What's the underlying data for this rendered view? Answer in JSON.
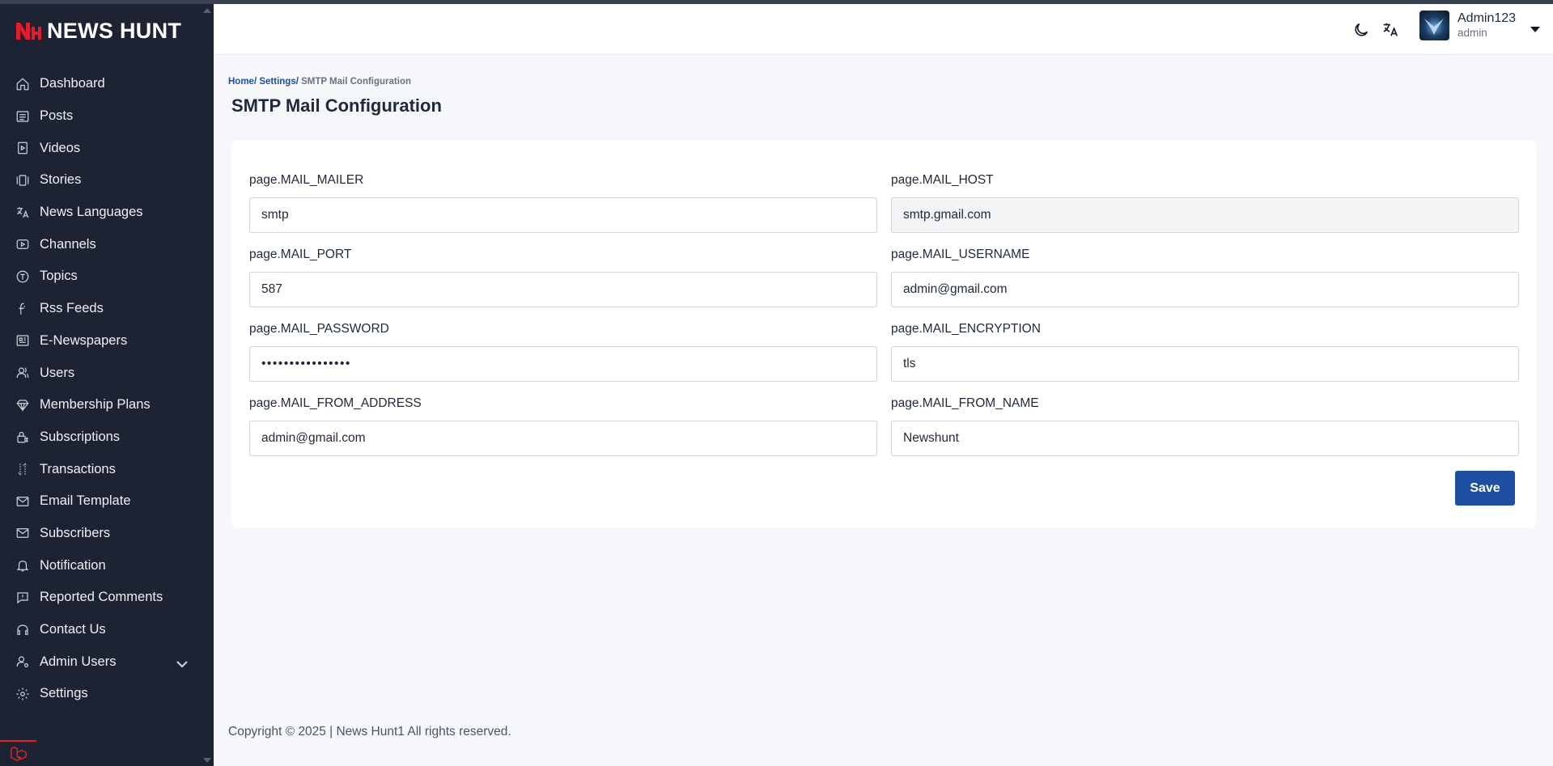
{
  "brand": {
    "name": "NEWS HUNT",
    "accent": "#e11d2e"
  },
  "sidebar": {
    "items": [
      {
        "label": "Dashboard",
        "icon": "home-icon"
      },
      {
        "label": "Posts",
        "icon": "list-icon"
      },
      {
        "label": "Videos",
        "icon": "video-file-icon"
      },
      {
        "label": "Stories",
        "icon": "stories-icon"
      },
      {
        "label": "News Languages",
        "icon": "translate-icon"
      },
      {
        "label": "Channels",
        "icon": "channel-icon"
      },
      {
        "label": "Topics",
        "icon": "topic-icon"
      },
      {
        "label": "Rss Feeds",
        "icon": "rss-icon"
      },
      {
        "label": "E-Newspapers",
        "icon": "newspaper-icon"
      },
      {
        "label": "Users",
        "icon": "users-icon"
      },
      {
        "label": "Membership Plans",
        "icon": "diamond-icon"
      },
      {
        "label": "Subscriptions",
        "icon": "subscription-icon"
      },
      {
        "label": "Transactions",
        "icon": "transactions-icon"
      },
      {
        "label": "Email Template",
        "icon": "mail-icon"
      },
      {
        "label": "Subscribers",
        "icon": "mail-icon"
      },
      {
        "label": "Notification",
        "icon": "bell-icon"
      },
      {
        "label": "Reported Comments",
        "icon": "comment-alert-icon"
      },
      {
        "label": "Contact Us",
        "icon": "headset-icon"
      },
      {
        "label": "Admin Users",
        "icon": "admin-user-icon",
        "expandable": true
      },
      {
        "label": "Settings",
        "icon": "gear-icon"
      }
    ]
  },
  "header": {
    "user": {
      "name": "Admin123",
      "role": "admin"
    }
  },
  "breadcrumb": {
    "home": "Home/",
    "settings": "Settings/",
    "current": "SMTP Mail Configuration"
  },
  "page": {
    "title": "SMTP Mail Configuration"
  },
  "form": {
    "mail_mailer": {
      "label": "page.MAIL_MAILER",
      "value": "smtp"
    },
    "mail_host": {
      "label": "page.MAIL_HOST",
      "value": "smtp.gmail.com"
    },
    "mail_port": {
      "label": "page.MAIL_PORT",
      "value": "587"
    },
    "mail_username": {
      "label": "page.MAIL_USERNAME",
      "value": "admin@gmail.com"
    },
    "mail_password": {
      "label": "page.MAIL_PASSWORD",
      "value": "••••••••••••••••"
    },
    "mail_encryption": {
      "label": "page.MAIL_ENCRYPTION",
      "value": "tls"
    },
    "mail_from_address": {
      "label": "page.MAIL_FROM_ADDRESS",
      "value": "admin@gmail.com"
    },
    "mail_from_name": {
      "label": "page.MAIL_FROM_NAME",
      "value": "Newshunt"
    },
    "save_label": "Save"
  },
  "footer": {
    "text": "Copyright © 2025 | News Hunt1 All rights reserved."
  },
  "colors": {
    "sidebar_bg": "#1d2333",
    "primary": "#1e4fa0",
    "page_bg": "#f6f7fb"
  }
}
